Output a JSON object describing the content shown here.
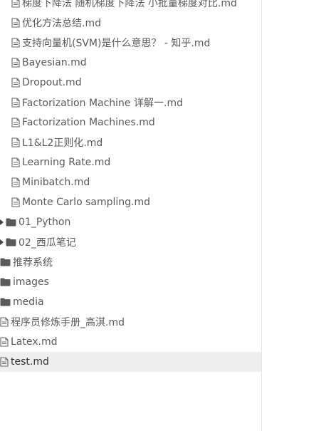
{
  "sidebar": {
    "items": [
      {
        "type": "file",
        "depth": 2,
        "label": "梯度下降法 随机梯度下降法 小批量梯度对比.md"
      },
      {
        "type": "file",
        "depth": 2,
        "label": "优化方法总结.md"
      },
      {
        "type": "file",
        "depth": 2,
        "label": "支持向量机(SVM)是什么意思？ - 知乎.md"
      },
      {
        "type": "file",
        "depth": 2,
        "label": "Bayesian.md"
      },
      {
        "type": "file",
        "depth": 2,
        "label": "Dropout.md"
      },
      {
        "type": "file",
        "depth": 2,
        "label": "Factorization Machine 详解一.md"
      },
      {
        "type": "file",
        "depth": 2,
        "label": "Factorization Machines.md"
      },
      {
        "type": "file",
        "depth": 2,
        "label": "L1&L2正则化.md"
      },
      {
        "type": "file",
        "depth": 2,
        "label": "Learning Rate.md"
      },
      {
        "type": "file",
        "depth": 2,
        "label": "Minibatch.md"
      },
      {
        "type": "file",
        "depth": 2,
        "label": "Monte Carlo sampling.md"
      },
      {
        "type": "folder",
        "depth": 1,
        "collapsed": true,
        "label": "01_Python"
      },
      {
        "type": "folder",
        "depth": 1,
        "collapsed": true,
        "label": "02_西瓜笔记"
      },
      {
        "type": "folder",
        "depth": 0,
        "label": "推荐系统"
      },
      {
        "type": "folder",
        "depth": 0,
        "label": "images"
      },
      {
        "type": "folder",
        "depth": 0,
        "label": "media"
      },
      {
        "type": "file",
        "depth": 0,
        "label": "程序员修炼手册_高淇.md"
      },
      {
        "type": "file",
        "depth": 0,
        "label": "Latex.md"
      },
      {
        "type": "file",
        "depth": 0,
        "active": true,
        "label": "test.md"
      }
    ]
  },
  "colors": {
    "text": "#5a5a5a",
    "active_bg": "#eeeeee",
    "divider": "#e6e6e6"
  },
  "icons": {
    "file": "file-document-icon",
    "folder": "folder-icon",
    "arrow": "caret-right-icon"
  }
}
